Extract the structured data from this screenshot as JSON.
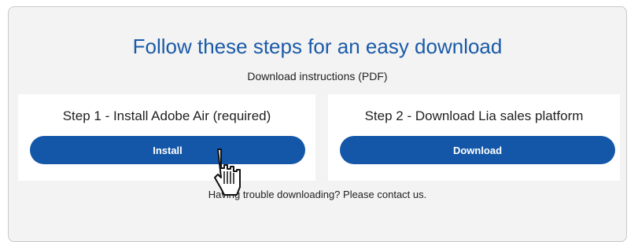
{
  "header": {
    "title": "Follow these steps for an easy download",
    "subtitle_link": "Download instructions (PDF)"
  },
  "steps": [
    {
      "title": "Step 1 - Install Adobe Air (required)",
      "button_label": "Install"
    },
    {
      "title": "Step 2 - Download Lia sales platform",
      "button_label": "Download"
    }
  ],
  "footer": {
    "help_text": "Having trouble downloading? Please contact us."
  },
  "colors": {
    "accent": "#1457a8",
    "title": "#1a5aa8",
    "panel_bg": "#f3f3f3",
    "card_bg": "#ffffff"
  },
  "cursor": {
    "icon": "hand-pointer-cursor-icon"
  }
}
